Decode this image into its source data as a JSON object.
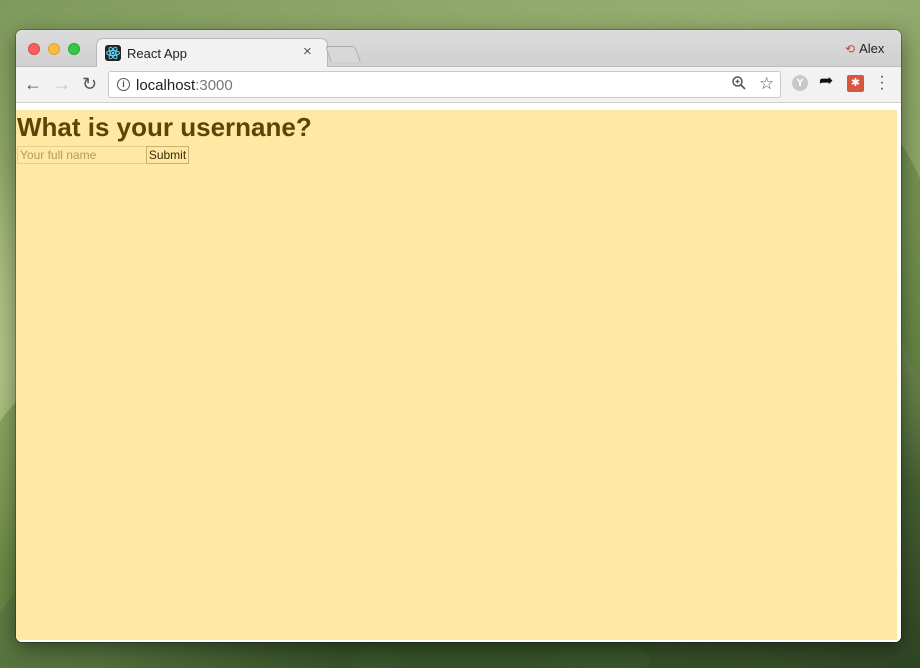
{
  "browser": {
    "tab": {
      "title": "React App",
      "close_glyph": "×",
      "icon": "react-logo-icon"
    },
    "profile": {
      "name": "Alex",
      "icon": "sync-error-icon"
    },
    "address_bar": {
      "host": "localhost",
      "port": ":3000"
    },
    "icons": {
      "back": "back-arrow-icon",
      "forward": "forward-arrow-icon",
      "reload": "reload-icon",
      "info": "info-icon",
      "zoom": "zoom-icon",
      "star": "bookmark-star-icon",
      "ext_yo": "extension-y-icon",
      "ext_share": "share-arrow-icon",
      "ext_bug": "extension-bug-icon",
      "menu": "menu-dots-icon"
    }
  },
  "app": {
    "heading": "What is your usernane?",
    "input": {
      "placeholder": "Your full name",
      "value": ""
    },
    "submit_label": "Submit",
    "background_color": "#ffe8a3",
    "text_color": "#5c4408"
  }
}
